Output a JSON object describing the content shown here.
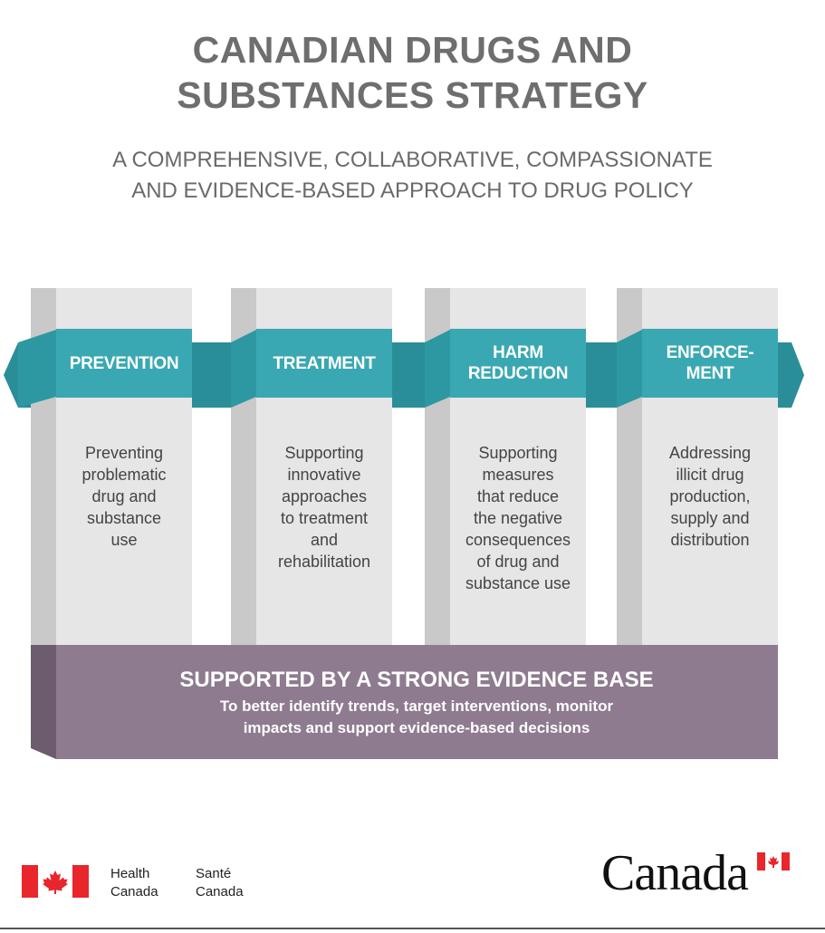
{
  "header": {
    "title_line1": "CANADIAN DRUGS AND",
    "title_line2": "SUBSTANCES STRATEGY",
    "subtitle_line1": "A COMPREHENSIVE, COLLABORATIVE, COMPASSIONATE",
    "subtitle_line2": "AND EVIDENCE-BASED APPROACH TO DRUG POLICY"
  },
  "pillars": [
    {
      "label_line1": "PREVENTION",
      "label_line2": "",
      "description": [
        "Preventing",
        "problematic",
        "drug and",
        "substance",
        "use"
      ]
    },
    {
      "label_line1": "TREATMENT",
      "label_line2": "",
      "description": [
        "Supporting",
        "innovative",
        "approaches",
        "to treatment",
        "and",
        "rehabilitation"
      ]
    },
    {
      "label_line1": "HARM",
      "label_line2": "REDUCTION",
      "description": [
        "Supporting",
        "measures",
        "that reduce",
        "the negative",
        "consequences",
        "of drug and",
        "substance use"
      ]
    },
    {
      "label_line1": "ENFORCE-",
      "label_line2": "MENT",
      "description": [
        "Addressing",
        "illicit drug",
        "production,",
        "supply and",
        "distribution"
      ]
    }
  ],
  "foundation": {
    "title": "SUPPORTED BY A STRONG EVIDENCE BASE",
    "line1": "To better identify trends, target interventions, monitor",
    "line2": "impacts and support evidence-based decisions"
  },
  "footer": {
    "dept_en_line1": "Health",
    "dept_en_line2": "Canada",
    "dept_fr_line1": "Santé",
    "dept_fr_line2": "Canada",
    "wordmark": "Canada"
  },
  "colors": {
    "teal": "#3aa8b2",
    "teal_dark": "#2a8e98",
    "pillar_face": "#e6e6e6",
    "pillar_side": "#c9c9c9",
    "foundation": "#8e7b8f",
    "foundation_side": "#6d5b6e",
    "flag_red": "#e8262b",
    "title_gray": "#6e6e6e"
  }
}
